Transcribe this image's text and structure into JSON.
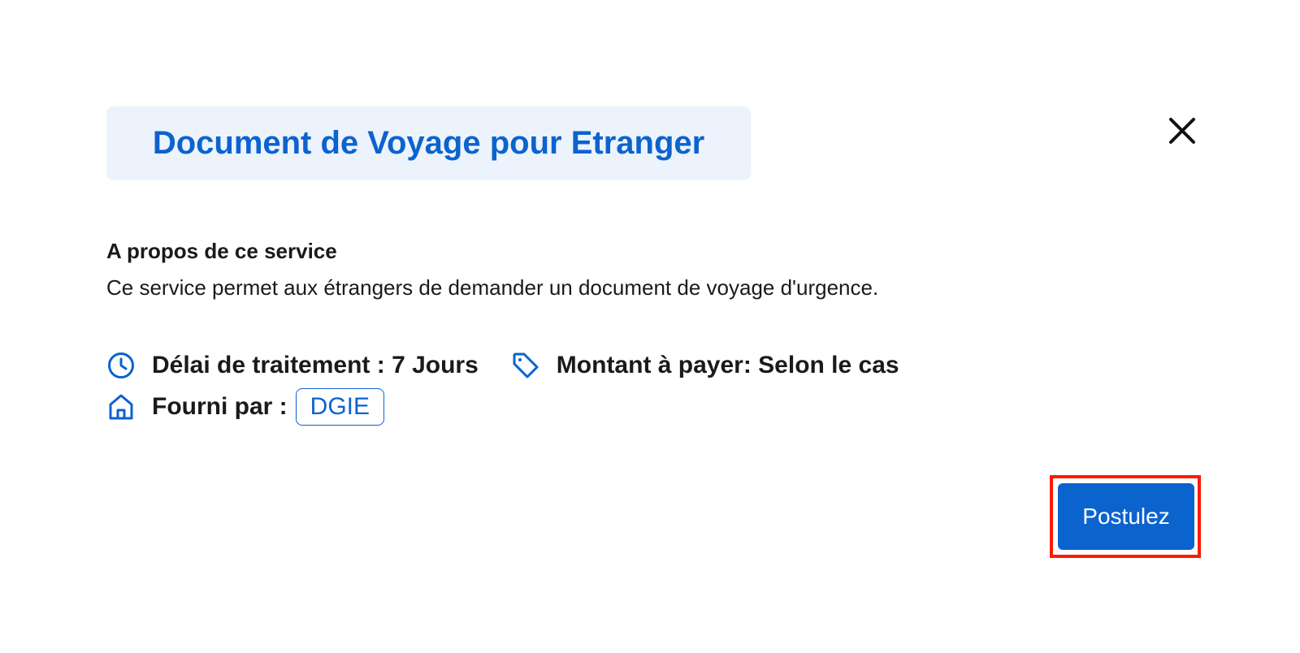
{
  "modal": {
    "title": "Document de Voyage pour Etranger",
    "close_icon": "close-icon"
  },
  "about": {
    "heading": "A propos de ce service",
    "description": "Ce service permet aux étrangers de demander un document de voyage d'urgence."
  },
  "details": {
    "processing": {
      "icon": "clock-icon",
      "text": "Délai de traitement : 7 Jours"
    },
    "price": {
      "icon": "tag-icon",
      "text": "Montant à payer: Selon le cas"
    },
    "provider": {
      "icon": "home-icon",
      "label": "Fourni par :",
      "value": "DGIE"
    }
  },
  "actions": {
    "apply_label": "Postulez"
  },
  "colors": {
    "accent": "#0b63ce",
    "title_bg": "#edf3fc",
    "highlight": "#ff1a00"
  }
}
